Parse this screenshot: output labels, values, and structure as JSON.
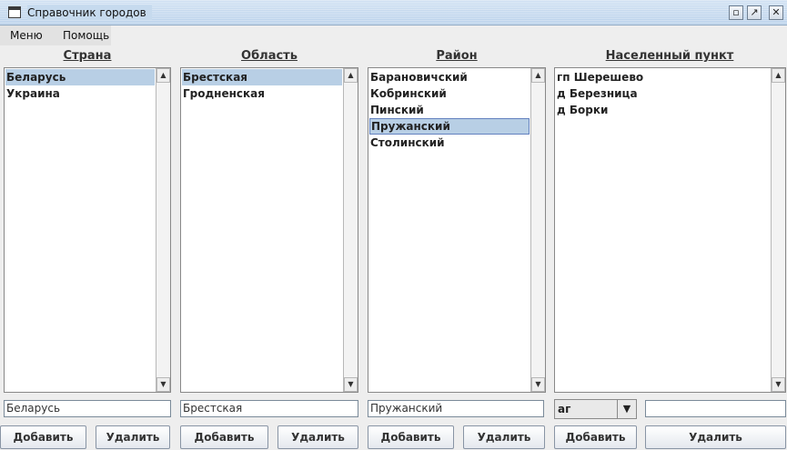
{
  "window": {
    "title": "Справочник городов",
    "icons": [
      "window-icon",
      "minimize-icon",
      "maximize-icon",
      "close-icon"
    ]
  },
  "menubar": {
    "items": [
      "Меню",
      "Помощь"
    ]
  },
  "columns": [
    {
      "header": "Страна",
      "items": [
        "Беларусь",
        "Украина"
      ],
      "selected_index": 0,
      "field_value": "Беларусь",
      "add_label": "Добавить",
      "delete_label": "Удалить"
    },
    {
      "header": "Область",
      "items": [
        "Брестская",
        "Гродненская"
      ],
      "selected_index": 0,
      "field_value": "Брестская",
      "add_label": "Добавить",
      "delete_label": "Удалить"
    },
    {
      "header": "Район",
      "items": [
        "Барановичский",
        "Кобринский",
        "Пинский",
        "Пружанский",
        "Столинский"
      ],
      "selected_index": 3,
      "field_value": "Пружанский",
      "add_label": "Добавить",
      "delete_label": "Удалить"
    },
    {
      "header": "Населенный пункт",
      "items": [
        "гп Шерешево",
        "д Березница",
        "д Борки"
      ],
      "selected_index": null,
      "combo_value": "аг",
      "field_value": "",
      "add_label": "Добавить",
      "delete_label": "Удалить"
    }
  ],
  "colors": {
    "selection": "#b8cfe5",
    "focus_border": "#6382bf",
    "titlebar": "#c6daee"
  }
}
